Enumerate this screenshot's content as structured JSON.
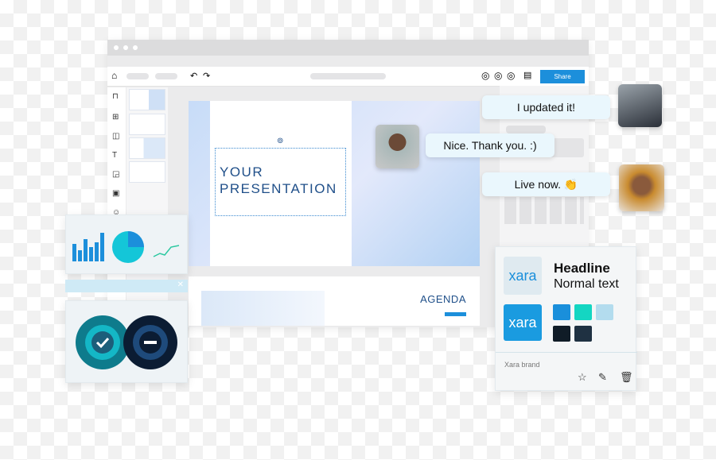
{
  "toolbar": {
    "share_label": "Share",
    "icons": [
      "home-icon",
      "undo-icon",
      "redo-icon",
      "user-icon",
      "user-icon",
      "user-icon",
      "comment-icon"
    ]
  },
  "slide": {
    "title_line1": "YOUR",
    "title_line2": "PRESENTATION"
  },
  "slide2": {
    "title": "AGENDA"
  },
  "chat": [
    {
      "text": "I updated it!"
    },
    {
      "text": "Nice. Thank you. :)"
    },
    {
      "text": "Live now. 👏"
    }
  ],
  "brand": {
    "logo_text": "xara",
    "headline": "Headline",
    "normal_text": "Normal text",
    "name": "Xara brand",
    "colors": [
      "#1a8fdb",
      "#14d6c2",
      "#b3dcee",
      "#101c27",
      "#1f3142"
    ]
  },
  "colors": {
    "accent": "#1c8fdb",
    "title": "#1f4f89"
  }
}
